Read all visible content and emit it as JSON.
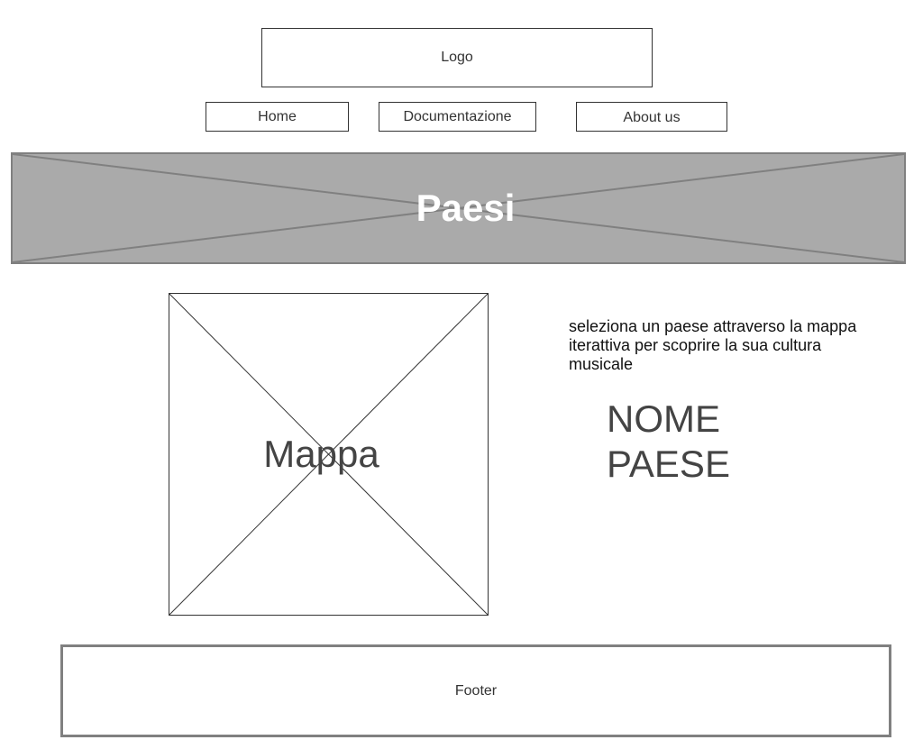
{
  "header": {
    "logo_text": "Logo"
  },
  "nav": {
    "home": "Home",
    "documentation": "Documentazione",
    "about": "About us"
  },
  "hero": {
    "title": "Paesi"
  },
  "map": {
    "label": "Mappa"
  },
  "info": {
    "description": "seleziona un paese attraverso la mappa iterattiva per scoprire la sua cultura musicale",
    "country_name_line1": "NOME",
    "country_name_line2": "PAESE"
  },
  "footer": {
    "text": "Footer"
  },
  "colors": {
    "hero_bg": "#aaaaaa",
    "hero_border": "#808080",
    "hero_title": "#ffffff",
    "outline": "#333333"
  }
}
